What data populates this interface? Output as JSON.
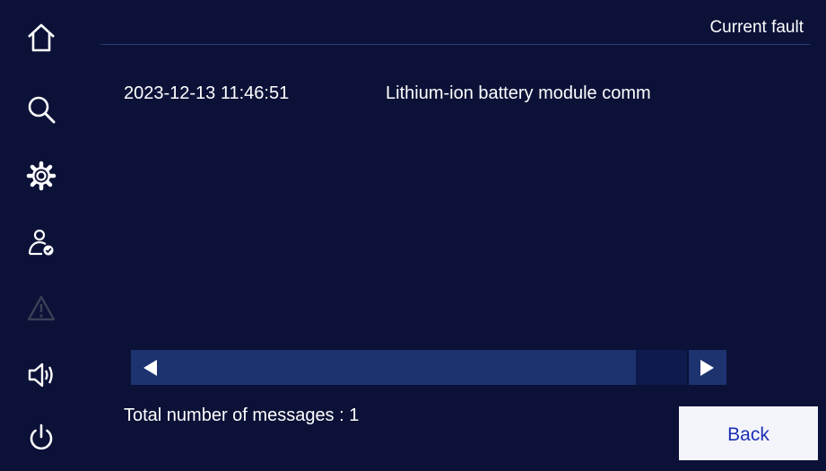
{
  "sidebar": {
    "items": [
      {
        "icon": "home-icon"
      },
      {
        "icon": "search-icon"
      },
      {
        "icon": "gear-icon"
      },
      {
        "icon": "user-check-icon"
      },
      {
        "icon": "warning-icon",
        "state": "disabled"
      },
      {
        "icon": "speaker-icon"
      },
      {
        "icon": "power-icon"
      }
    ]
  },
  "header": {
    "title": "Current fault"
  },
  "faults": [
    {
      "timestamp": "2023-12-13 11:46:51",
      "message": "Lithium-ion battery module comm"
    }
  ],
  "scrollbar": {
    "position": 0
  },
  "footer": {
    "total_label": "Total number of messages : 1",
    "back_label": "Back"
  },
  "colors": {
    "background": "#0b1137",
    "scroll_thumb": "#1d3370",
    "button_bg": "#f3f5fb",
    "button_text": "#1b2fb3",
    "disabled_icon": "#3a3f56"
  }
}
